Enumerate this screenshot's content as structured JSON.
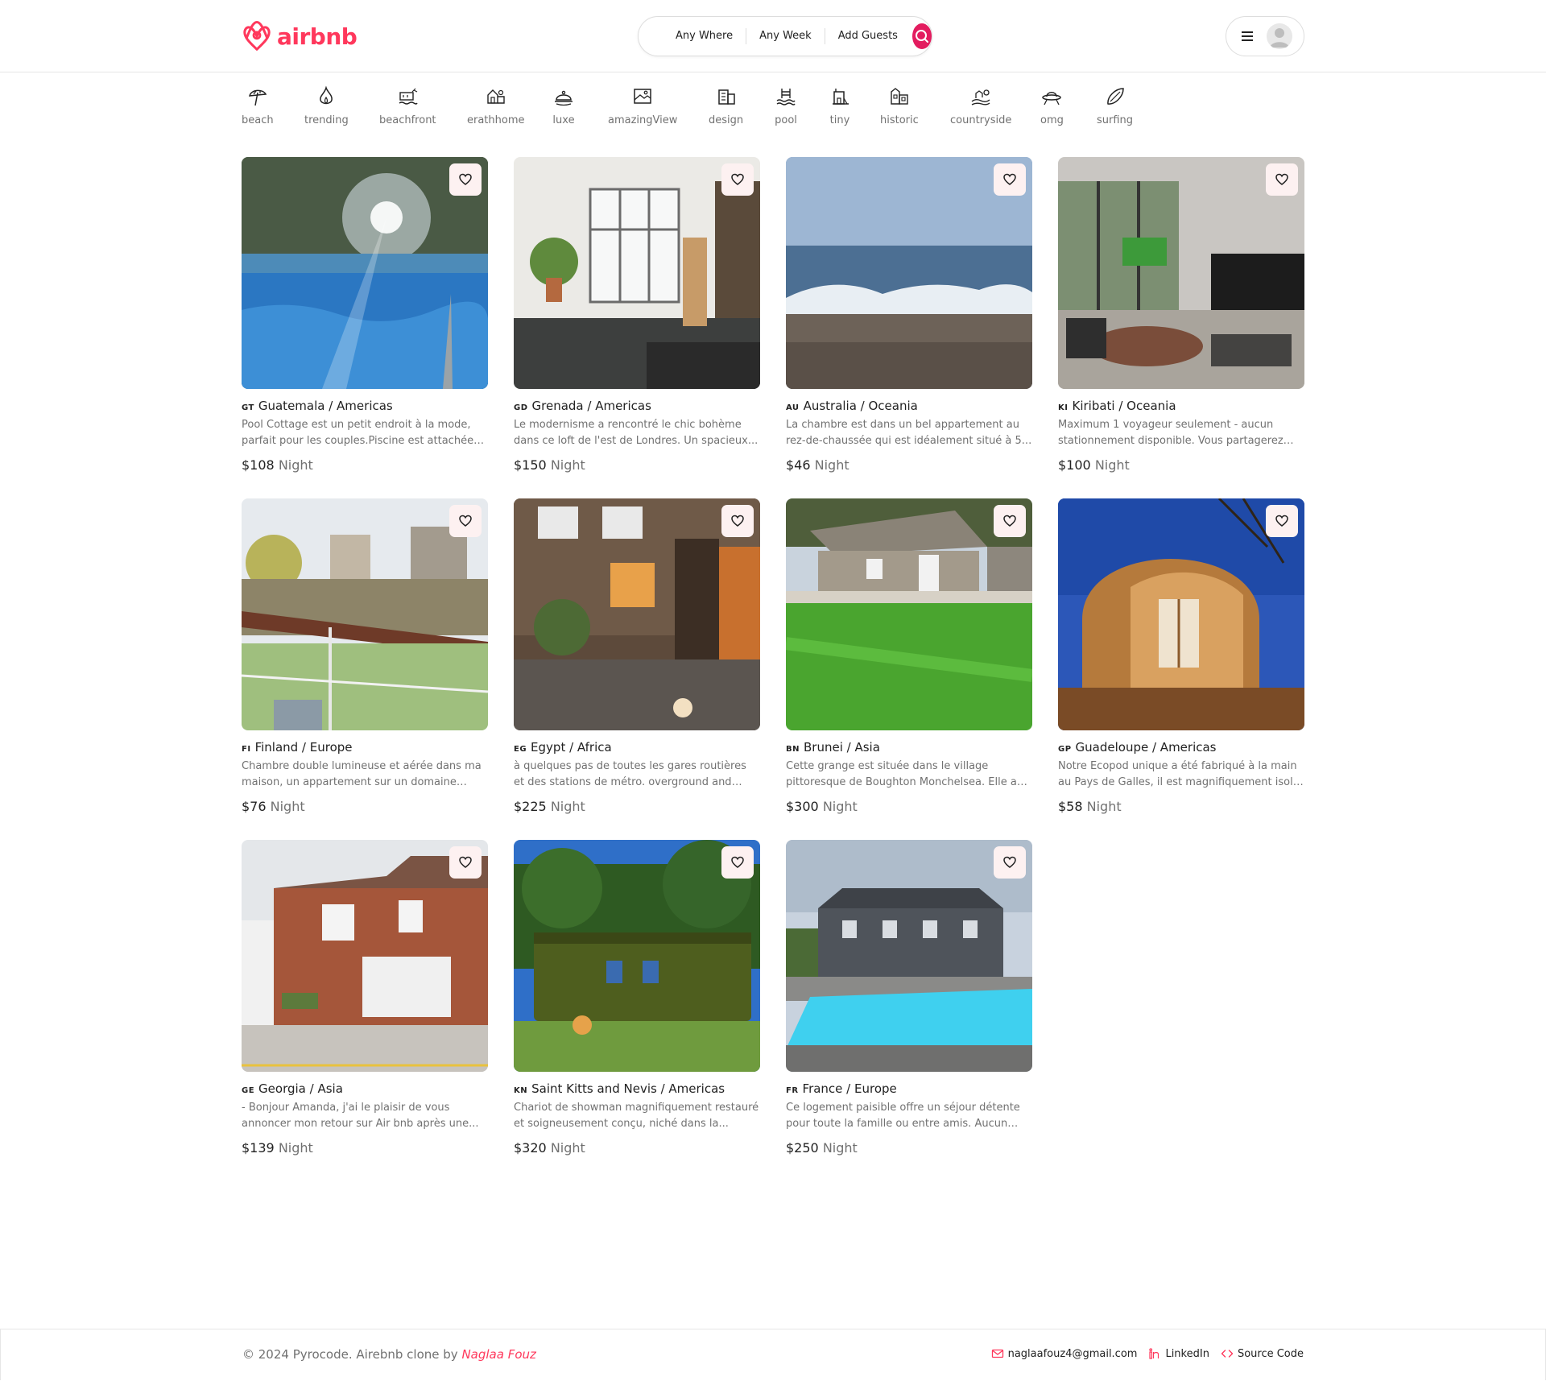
{
  "brand": {
    "name": "airbnb",
    "color": "#ff385c"
  },
  "search": {
    "where": "Any Where",
    "week": "Any Week",
    "guests": "Add Guests",
    "button_color": "#e31c5f"
  },
  "categories": [
    {
      "label": "beach",
      "icon": "umbrella-icon"
    },
    {
      "label": "trending",
      "icon": "flame-icon"
    },
    {
      "label": "beachfront",
      "icon": "beachfront-icon"
    },
    {
      "label": "erathhome",
      "icon": "earthhome-icon"
    },
    {
      "label": "luxe",
      "icon": "bell-icon"
    },
    {
      "label": "amazingView",
      "icon": "view-icon"
    },
    {
      "label": "design",
      "icon": "building-icon"
    },
    {
      "label": "pool",
      "icon": "pool-icon"
    },
    {
      "label": "tiny",
      "icon": "tiny-house-icon"
    },
    {
      "label": "historic",
      "icon": "historic-icon"
    },
    {
      "label": "countryside",
      "icon": "countryside-icon"
    },
    {
      "label": "omg",
      "icon": "ufo-icon"
    },
    {
      "label": "surfing",
      "icon": "surfboard-icon"
    }
  ],
  "listings": [
    {
      "code": "GT",
      "location": "Guatemala / Americas",
      "desc": "Pool Cottage est un petit endroit à la mode, parfait pour les couples.Piscine est attachée au...",
      "price": "$108",
      "unit": "Night"
    },
    {
      "code": "GD",
      "location": "Grenada / Americas",
      "desc": "Le modernisme a rencontré le chic bohème dans ce loft de l'est de Londres. Un spacieux...",
      "price": "$150",
      "unit": "Night"
    },
    {
      "code": "AU",
      "location": "Australia / Oceania",
      "desc": "La chambre est dans un bel appartement au rez-de-chaussée qui est idéalement situé à 5...",
      "price": "$46",
      "unit": "Night"
    },
    {
      "code": "KI",
      "location": "Kiribati / Oceania",
      "desc": "Maximum 1 voyageur seulement - aucun stationnement disponible. Vous partagerez la...",
      "price": "$100",
      "unit": "Night"
    },
    {
      "code": "FI",
      "location": "Finland / Europe",
      "desc": "Chambre double lumineuse et aérée dans ma maison, un appartement sur un domaine privé...",
      "price": "$76",
      "unit": "Night"
    },
    {
      "code": "EG",
      "location": "Egypt / Africa",
      "desc": "à quelques pas de toutes les gares routières et des stations de métro. overground and new...",
      "price": "$225",
      "unit": "Night"
    },
    {
      "code": "BN",
      "location": "Brunei / Asia",
      "desc": "Cette grange est située dans le village pittoresque de Boughton Monchelsea. Elle a so...",
      "price": "$300",
      "unit": "Night"
    },
    {
      "code": "GP",
      "location": "Guadeloupe / Americas",
      "desc": "Notre Ecopod unique a été fabriqué à la main au Pays de Galles, il est magnifiquement isolé ave...",
      "price": "$58",
      "unit": "Night"
    },
    {
      "code": "GE",
      "location": "Georgia / Asia",
      "desc": "- Bonjour Amanda, j'ai le plaisir de vous annoncer mon retour sur Air bnb après une...",
      "price": "$139",
      "unit": "Night"
    },
    {
      "code": "KN",
      "location": "Saint Kitts and Nevis / Americas",
      "desc": "Chariot de showman magnifiquement restauré et soigneusement conçu, niché dans la...",
      "price": "$320",
      "unit": "Night"
    },
    {
      "code": "FR",
      "location": "France / Europe",
      "desc": "Ce logement paisible offre un séjour détente pour toute la famille ou entre amis. Aucun vis-...",
      "price": "$250",
      "unit": "Night"
    }
  ],
  "footer": {
    "copyright": "© 2024 Pyrocode. Airebnb clone by",
    "author": "Naglaa Fouz",
    "email": "naglaafouz4@gmail.com",
    "linkedin": "LinkedIn",
    "source": "Source Code"
  }
}
